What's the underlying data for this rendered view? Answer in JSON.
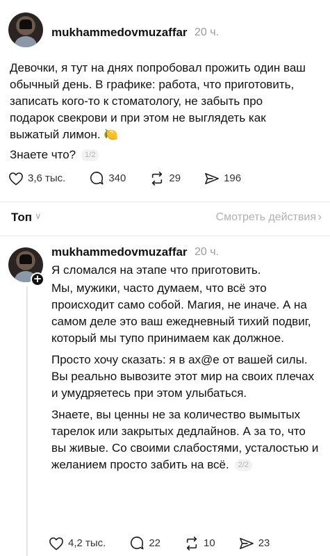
{
  "post1": {
    "username": "mukhammedovmuzaffar",
    "time": "20 ч.",
    "text": "Девочки, я тут на днях попробовал прожить один ваш обычный день. В графике: работа, что приготовить, записать кого-то к стоматологу, не забыть про подарок свекрови и при этом не выглядеть как выжатый лимон. 🍋",
    "closing": "Знаете что?",
    "page_indicator": "1/2",
    "likes": "3,6 тыс.",
    "comments": "340",
    "reposts": "29",
    "shares": "196"
  },
  "sort": {
    "label": "Топ",
    "activity_link": "Смотреть действия"
  },
  "post2": {
    "username": "mukhammedovmuzaffar",
    "time": "20 ч.",
    "paragraphs": [
      "Я сломался на этапе что приготовить.",
      "Мы, мужики, часто думаем, что всё это происходит само собой. Магия, не иначе. А на самом деле это ваш ежедневный тихий подвиг, который мы тупо принимаем как должное.",
      "Просто хочу сказать: я в ах@е от вашей силы. Вы реально вывозите этот мир на своих плечах и умудряетесь при этом улыбаться.",
      "Знаете, вы ценны не за количество вымытых тарелок или закрытых дедлайнов. А за то, что вы живые. Со своими слабостями, усталостью и желанием просто забить на всё."
    ],
    "page_indicator": "2/2",
    "likes": "4,2 тыс.",
    "comments": "22",
    "reposts": "10",
    "shares": "23"
  },
  "icons": {
    "like": "heart-icon",
    "comment": "comment-icon",
    "repost": "repost-icon",
    "share": "share-icon",
    "follow": "plus-icon",
    "chevron": "chevron-icon"
  },
  "colors": {
    "text": "#111111",
    "muted": "#9a9a9a",
    "divider": "#e8e8e8"
  }
}
